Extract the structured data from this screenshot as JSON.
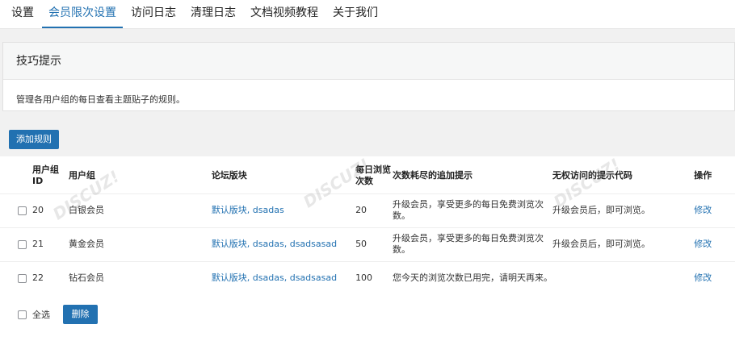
{
  "tabs": [
    {
      "label": "设置",
      "active": false
    },
    {
      "label": "会员限次设置",
      "active": true
    },
    {
      "label": "访问日志",
      "active": false
    },
    {
      "label": "清理日志",
      "active": false
    },
    {
      "label": "文档视频教程",
      "active": false
    },
    {
      "label": "关于我们",
      "active": false
    }
  ],
  "tips": {
    "title": "技巧提示",
    "text": "管理各用户组的每日查看主题贴子的规则。"
  },
  "add_button_label": "添加规则",
  "table": {
    "headers": {
      "id": "用户组ID",
      "group": "用户组",
      "forum": "论坛版块",
      "count": "每日浏览次数",
      "msg": "次数耗尽的追加提示",
      "code": "无权访问的提示代码",
      "op": "操作"
    },
    "rows": [
      {
        "id": "20",
        "group": "白银会员",
        "forum": "默认版块, dsadas",
        "count": "20",
        "msg": "升级会员，享受更多的每日免费浏览次数。",
        "code": "升级会员后，即可浏览。",
        "op": "修改"
      },
      {
        "id": "21",
        "group": "黄金会员",
        "forum": "默认版块, dsadas, dsadsasad",
        "count": "50",
        "msg": "升级会员，享受更多的每日免费浏览次数。",
        "code": "升级会员后，即可浏览。",
        "op": "修改"
      },
      {
        "id": "22",
        "group": "钻石会员",
        "forum": "默认版块, dsadas, dsadsasad",
        "count": "100",
        "msg": "您今天的浏览次数已用完，请明天再来。",
        "code": "",
        "op": "修改"
      }
    ]
  },
  "footer": {
    "select_all_label": "全选",
    "delete_label": "删除"
  }
}
